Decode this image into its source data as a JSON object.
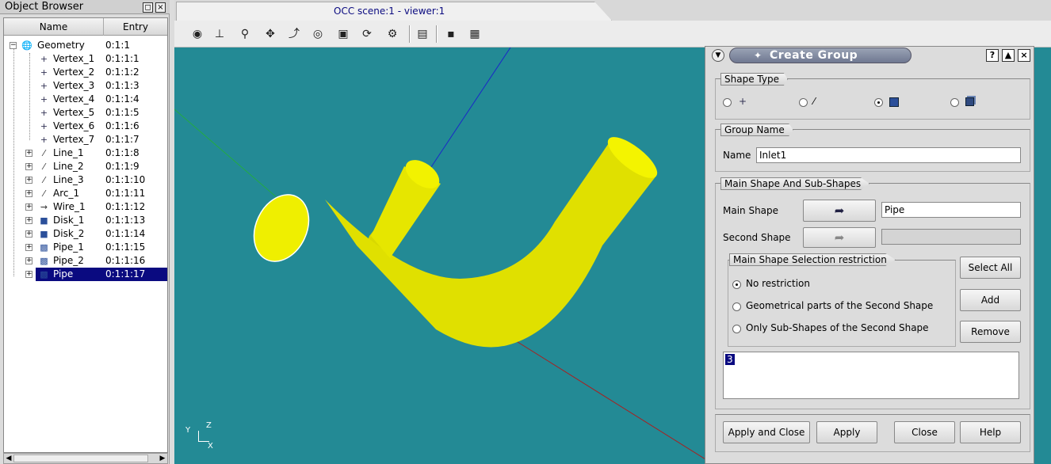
{
  "object_browser": {
    "title": "Object Browser",
    "columns": {
      "name": "Name",
      "entry": "Entry"
    },
    "items": [
      {
        "name": "Geometry",
        "entry": "0:1:1",
        "icon": "geometry-icon",
        "level": 0
      },
      {
        "name": "Vertex_1",
        "entry": "0:1:1:1",
        "icon": "vertex-icon",
        "level": 1
      },
      {
        "name": "Vertex_2",
        "entry": "0:1:1:2",
        "icon": "vertex-icon",
        "level": 1
      },
      {
        "name": "Vertex_3",
        "entry": "0:1:1:3",
        "icon": "vertex-icon",
        "level": 1
      },
      {
        "name": "Vertex_4",
        "entry": "0:1:1:4",
        "icon": "vertex-icon",
        "level": 1
      },
      {
        "name": "Vertex_5",
        "entry": "0:1:1:5",
        "icon": "vertex-icon",
        "level": 1
      },
      {
        "name": "Vertex_6",
        "entry": "0:1:1:6",
        "icon": "vertex-icon",
        "level": 1
      },
      {
        "name": "Vertex_7",
        "entry": "0:1:1:7",
        "icon": "vertex-icon",
        "level": 1
      },
      {
        "name": "Line_1",
        "entry": "0:1:1:8",
        "icon": "line-icon",
        "level": 1
      },
      {
        "name": "Line_2",
        "entry": "0:1:1:9",
        "icon": "line-icon",
        "level": 1
      },
      {
        "name": "Line_3",
        "entry": "0:1:1:10",
        "icon": "line-icon",
        "level": 1
      },
      {
        "name": "Arc_1",
        "entry": "0:1:1:11",
        "icon": "arc-icon",
        "level": 1
      },
      {
        "name": "Wire_1",
        "entry": "0:1:1:12",
        "icon": "wire-icon",
        "level": 1
      },
      {
        "name": "Disk_1",
        "entry": "0:1:1:13",
        "icon": "disk-icon",
        "level": 1
      },
      {
        "name": "Disk_2",
        "entry": "0:1:1:14",
        "icon": "disk-icon",
        "level": 1
      },
      {
        "name": "Pipe_1",
        "entry": "0:1:1:15",
        "icon": "pipe-icon",
        "level": 1
      },
      {
        "name": "Pipe_2",
        "entry": "0:1:1:16",
        "icon": "pipe-icon",
        "level": 1
      },
      {
        "name": "Pipe",
        "entry": "0:1:1:17",
        "icon": "pipe-icon",
        "level": 1
      }
    ]
  },
  "viewer": {
    "tab_title": "OCC scene:1 - viewer:1",
    "axis_labels": {
      "y": "Y",
      "z": "Z",
      "x": "X"
    },
    "background_color": "#238a95"
  },
  "dialog": {
    "title": "Create Group",
    "shape_type": {
      "title": "Shape Type",
      "options": [
        {
          "icon": "vertex-icon",
          "selected": false
        },
        {
          "icon": "edge-icon",
          "selected": false
        },
        {
          "icon": "face-icon",
          "selected": true
        },
        {
          "icon": "solid-icon",
          "selected": false
        }
      ]
    },
    "group_name": {
      "title": "Group Name",
      "label": "Name",
      "value": "Inlet1"
    },
    "main_shape": {
      "title": "Main Shape And Sub-Shapes",
      "main_label": "Main Shape",
      "main_value": "Pipe",
      "second_label": "Second Shape",
      "second_value": "",
      "restriction_title": "Main Shape Selection restriction",
      "restrictions": [
        {
          "label": "No restriction",
          "selected": true
        },
        {
          "label": "Geometrical parts of the Second Shape",
          "selected": false
        },
        {
          "label": "Only Sub-Shapes of the Second Shape",
          "selected": false
        }
      ],
      "buttons": {
        "select_all": "Select All",
        "add": "Add",
        "remove": "Remove"
      },
      "ids": [
        "3"
      ]
    },
    "footer": {
      "apply_close": "Apply and Close",
      "apply": "Apply",
      "close": "Close",
      "help": "Help"
    }
  }
}
